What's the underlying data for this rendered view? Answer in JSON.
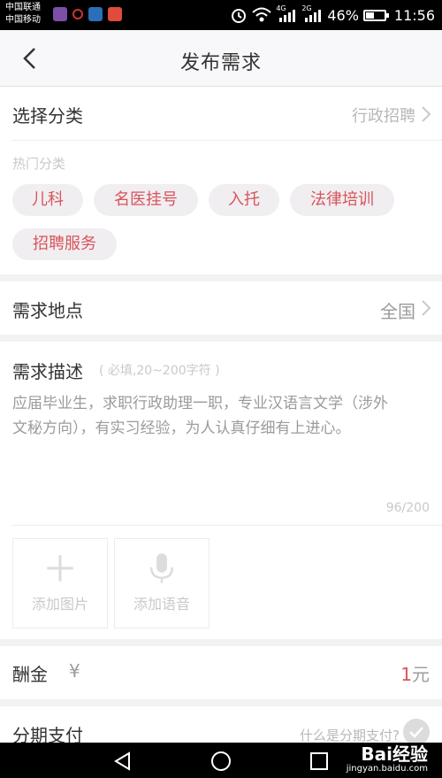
{
  "status_bar": {
    "carrier_1": "中国联通",
    "carrier_2": "中国移动",
    "net_1": "4G",
    "net_2": "2G",
    "battery": "46%",
    "time": "11:56"
  },
  "header": {
    "title": "发布需求"
  },
  "category": {
    "label": "选择分类",
    "value": "行政招聘",
    "hot_title": "热门分类",
    "tags": [
      "儿科",
      "名医挂号",
      "入托",
      "法律培训",
      "招聘服务"
    ]
  },
  "location": {
    "label": "需求地点",
    "value": "全国"
  },
  "description": {
    "label": "需求描述",
    "hint": "( 必填,20~200字符 )",
    "line_1": "应届毕业生，求职行政助理一职，专业汉语言文学（涉外",
    "line_2": "文秘方向），有实习经验，为人认真仔细有上进心。",
    "counter": "96/200",
    "add_image": "添加图片",
    "add_voice": "添加语音"
  },
  "reward": {
    "label": "酬金",
    "currency": "¥",
    "amount": "1",
    "unit": "元"
  },
  "installment": {
    "label": "分期支付",
    "link": "什么是分期支付?",
    "checked": false
  },
  "watermark": {
    "brand": "Bai经验",
    "url": "jingyan.baidu.com"
  },
  "colors": {
    "accent": "#d8545c",
    "tag_bg": "#f0eef0",
    "muted": "#b8b8b8"
  },
  "icons": [
    "back-arrow-icon",
    "chevron-right-icon",
    "plus-icon",
    "microphone-icon",
    "check-circle-icon",
    "nav-back-icon",
    "nav-home-icon",
    "nav-recent-icon"
  ]
}
